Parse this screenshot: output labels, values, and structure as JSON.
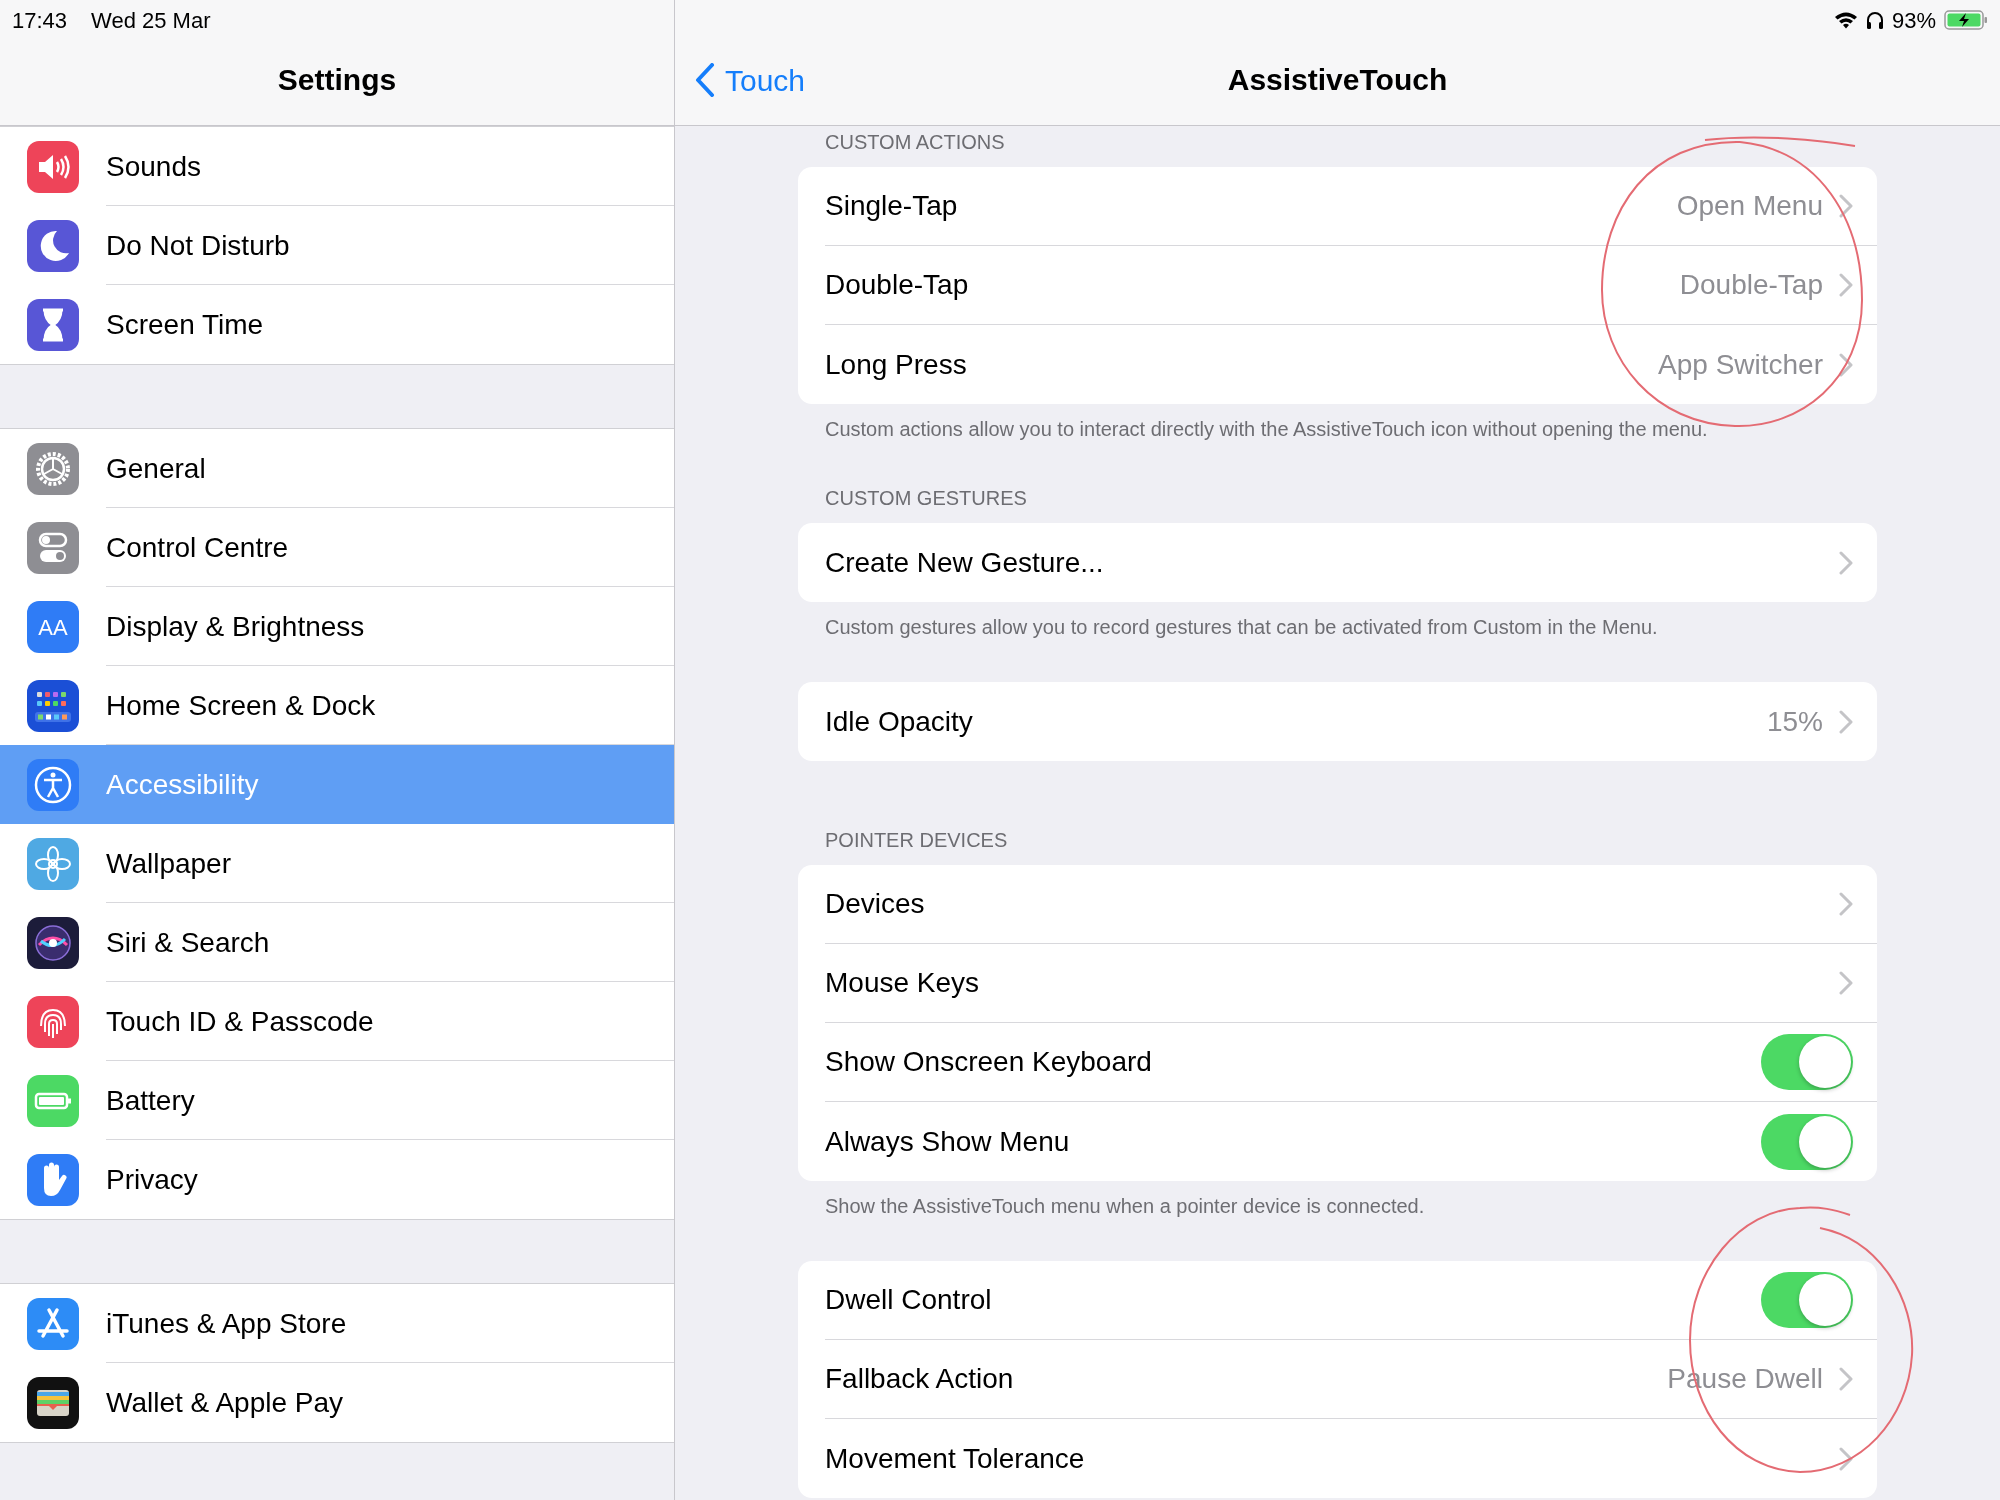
{
  "status_bar": {
    "time": "17:43",
    "date": "Wed 25 Mar",
    "battery": "93%"
  },
  "sidebar": {
    "title": "Settings",
    "groups": [
      [
        {
          "label": "Sounds",
          "selected": false
        },
        {
          "label": "Do Not Disturb",
          "selected": false
        },
        {
          "label": "Screen Time",
          "selected": false
        }
      ],
      [
        {
          "label": "General",
          "selected": false
        },
        {
          "label": "Control Centre",
          "selected": false
        },
        {
          "label": "Display & Brightness",
          "selected": false,
          "icon_glyph": "AA"
        },
        {
          "label": "Home Screen & Dock",
          "selected": false
        },
        {
          "label": "Accessibility",
          "selected": true
        },
        {
          "label": "Wallpaper",
          "selected": false
        },
        {
          "label": "Siri & Search",
          "selected": false
        },
        {
          "label": "Touch ID & Passcode",
          "selected": false
        },
        {
          "label": "Battery",
          "selected": false
        },
        {
          "label": "Privacy",
          "selected": false
        }
      ],
      [
        {
          "label": "iTunes & App Store",
          "selected": false
        },
        {
          "label": "Wallet & Apple Pay",
          "selected": false
        }
      ]
    ]
  },
  "detail": {
    "back": "Touch",
    "title": "AssistiveTouch",
    "sections": [
      {
        "header": "CUSTOM ACTIONS",
        "rows": [
          {
            "kind": "link",
            "label": "Single-Tap",
            "value": "Open Menu"
          },
          {
            "kind": "link",
            "label": "Double-Tap",
            "value": "Double-Tap"
          },
          {
            "kind": "link",
            "label": "Long Press",
            "value": "App Switcher"
          }
        ],
        "footer": "Custom actions allow you to interact directly with the AssistiveTouch icon without opening the menu."
      },
      {
        "header": "CUSTOM GESTURES",
        "rows": [
          {
            "kind": "link",
            "label": "Create New Gesture..."
          }
        ],
        "footer": "Custom gestures allow you to record gestures that can be activated from Custom in the Menu."
      },
      {
        "rows": [
          {
            "kind": "link",
            "label": "Idle Opacity",
            "value": "15%"
          }
        ]
      },
      {
        "header": "POINTER DEVICES",
        "rows": [
          {
            "kind": "link",
            "label": "Devices"
          },
          {
            "kind": "link",
            "label": "Mouse Keys"
          },
          {
            "kind": "toggle",
            "label": "Show Onscreen Keyboard",
            "on": true
          },
          {
            "kind": "toggle",
            "label": "Always Show Menu",
            "on": true
          }
        ],
        "footer": "Show the AssistiveTouch menu when a pointer device is connected."
      },
      {
        "rows": [
          {
            "kind": "toggle",
            "label": "Dwell Control",
            "on": true
          },
          {
            "kind": "link",
            "label": "Fallback Action",
            "value": "Pause Dwell"
          },
          {
            "kind": "link",
            "label": "Movement Tolerance"
          }
        ]
      }
    ]
  }
}
